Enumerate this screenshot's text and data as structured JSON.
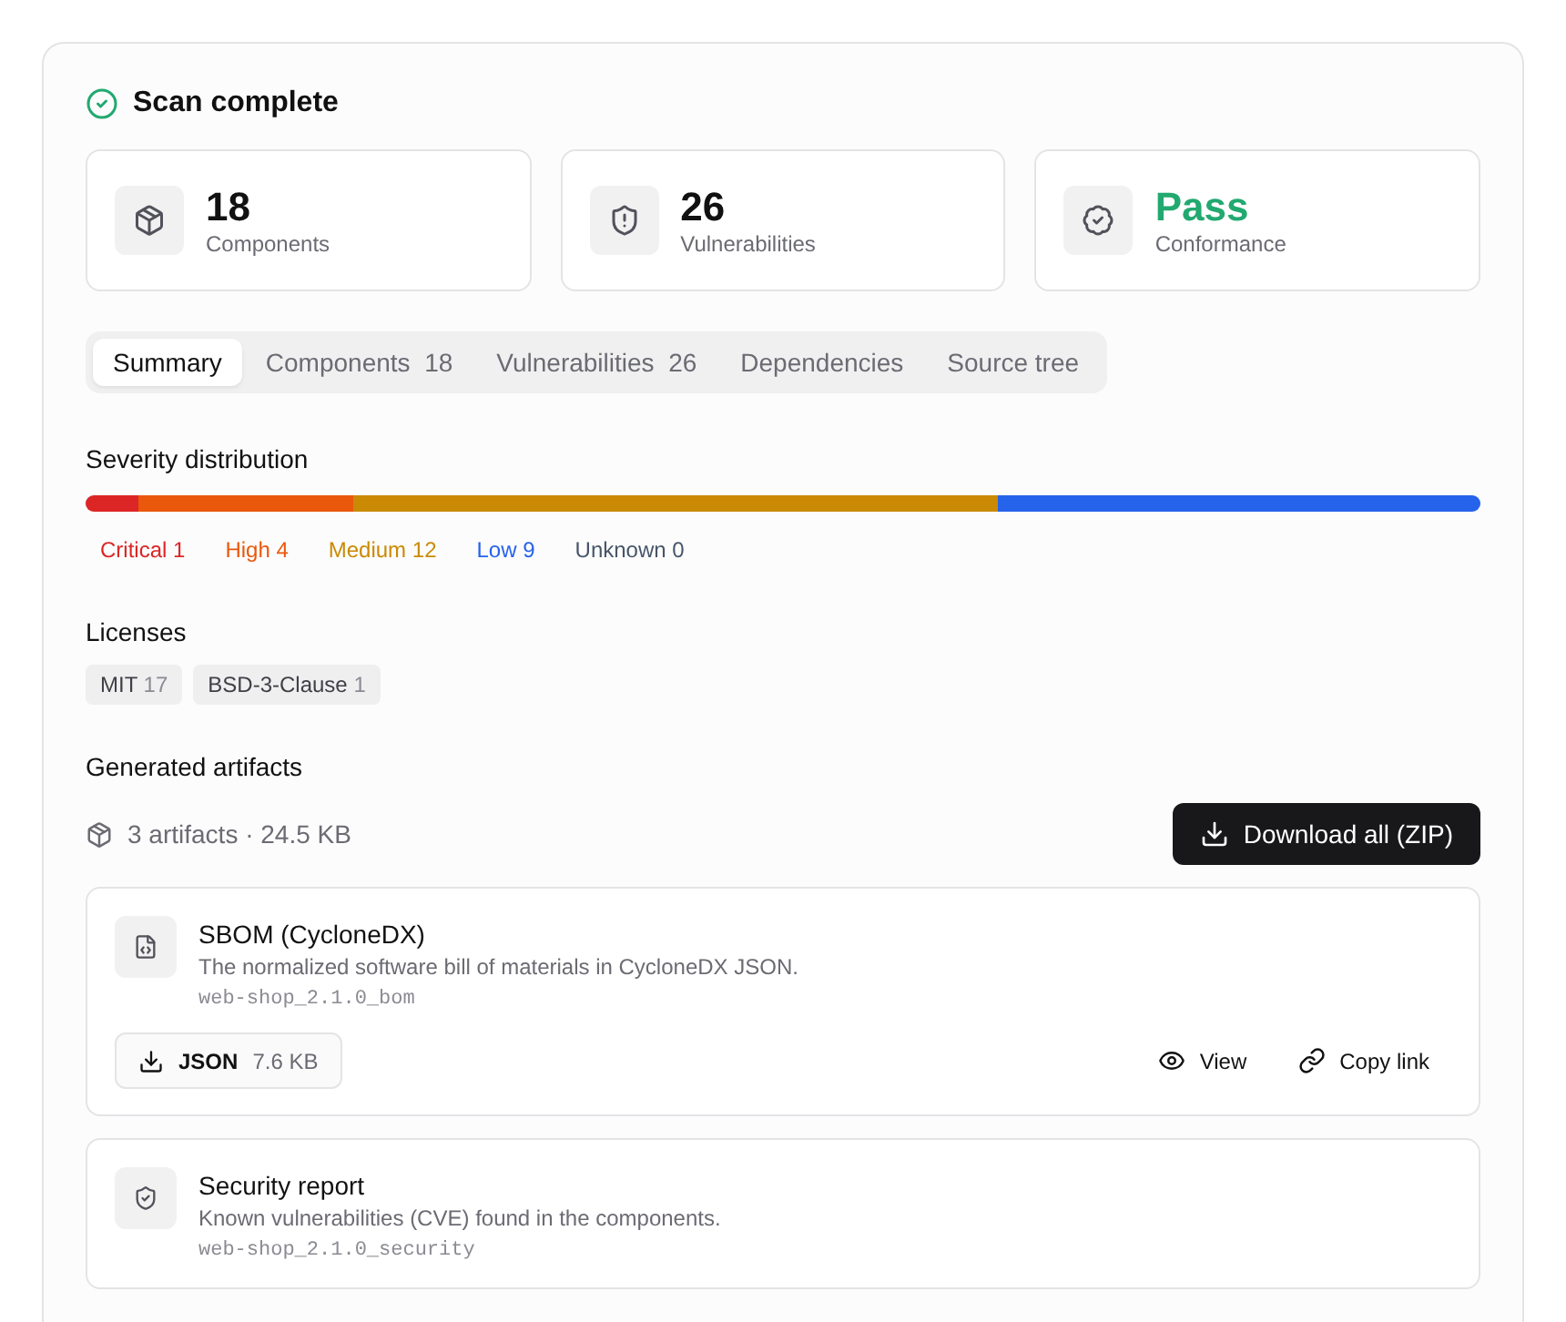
{
  "status": {
    "title": "Scan complete"
  },
  "stats": [
    {
      "kind": "count",
      "value": "18",
      "label": "Components"
    },
    {
      "kind": "count",
      "value": "26",
      "label": "Vulnerabilities"
    },
    {
      "kind": "status",
      "value": "Pass",
      "label": "Conformance"
    }
  ],
  "tabs": [
    {
      "label": "Summary",
      "selected": true
    },
    {
      "label": "Components",
      "count": "18",
      "selected": false
    },
    {
      "label": "Vulnerabilities",
      "count": "26",
      "selected": false
    },
    {
      "label": "Dependencies",
      "selected": false
    },
    {
      "label": "Source tree",
      "selected": false
    }
  ],
  "severity": {
    "title": "Severity distribution",
    "segments": [
      {
        "label": "Critical 1",
        "level": 0.0385,
        "color": "#dc2626"
      },
      {
        "label": "High 4",
        "level": 0.1538,
        "color": "#ea580c"
      },
      {
        "label": "Medium 12",
        "level": 0.4615,
        "color": "#ca8a04"
      },
      {
        "label": "Low 9",
        "level": 0.3462,
        "color": "#2563eb"
      },
      {
        "label": "Unknown 0",
        "color": "#475569"
      }
    ]
  },
  "licenses": {
    "title": "Licenses",
    "items": [
      {
        "name": "MIT",
        "count": "17"
      },
      {
        "name": "BSD-3-Clause",
        "count": "1"
      }
    ]
  },
  "artifacts": {
    "title": "Generated artifacts",
    "summary": "3 artifacts · 24.5 KB",
    "download_all": "Download all (ZIP)",
    "items": [
      {
        "kind": "sbom",
        "title": "SBOM (CycloneDX)",
        "description": "The normalized software bill of materials in CycloneDX JSON.",
        "file": "web-shop_2.1.0_bom",
        "format": "JSON",
        "size": "7.6 KB",
        "actions": [
          "View",
          "Copy link"
        ]
      },
      {
        "kind": "security",
        "title": "Security report",
        "description": "Known vulnerabilities (CVE) found in the components.",
        "file": "web-shop_2.1.0_security"
      }
    ]
  }
}
